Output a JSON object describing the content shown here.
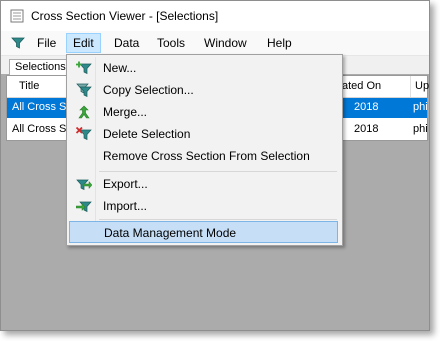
{
  "window": {
    "title": "Cross Section Viewer - [Selections]"
  },
  "menubar": {
    "items": [
      {
        "label": "File"
      },
      {
        "label": "Edit"
      },
      {
        "label": "Data"
      },
      {
        "label": "Tools"
      },
      {
        "label": "Window"
      },
      {
        "label": "Help"
      }
    ]
  },
  "tabs": [
    {
      "label": "Selections"
    }
  ],
  "grid": {
    "columns": [
      {
        "label": "Title"
      },
      {
        "label": "ated On"
      },
      {
        "label": "Up"
      }
    ],
    "rows": [
      {
        "title": "All Cross Se",
        "created": "2018",
        "updated": "phil",
        "selected": true
      },
      {
        "title": "All Cross Se",
        "created": "2018",
        "updated": "phil",
        "selected": false
      }
    ]
  },
  "edit_menu": {
    "items": [
      {
        "label": "New...",
        "icon": "funnel-add-icon"
      },
      {
        "label": "Copy Selection...",
        "icon": "funnel-copy-icon"
      },
      {
        "label": "Merge...",
        "icon": "merge-icon"
      },
      {
        "label": "Delete Selection",
        "icon": "funnel-delete-icon"
      },
      {
        "label": "Remove Cross Section From Selection",
        "icon": ""
      },
      {
        "label": "Export...",
        "icon": "export-icon"
      },
      {
        "label": "Import...",
        "icon": "import-icon"
      },
      {
        "label": "Data Management Mode",
        "icon": ""
      }
    ],
    "highlighted": "Data Management Mode"
  },
  "colors": {
    "selection_blue": "#0078d7",
    "menu_highlight": "#c6dff7",
    "funnel_teal": "#2e8a8a",
    "arrow_green": "#3aa53a",
    "delete_red": "#d12c2c"
  }
}
